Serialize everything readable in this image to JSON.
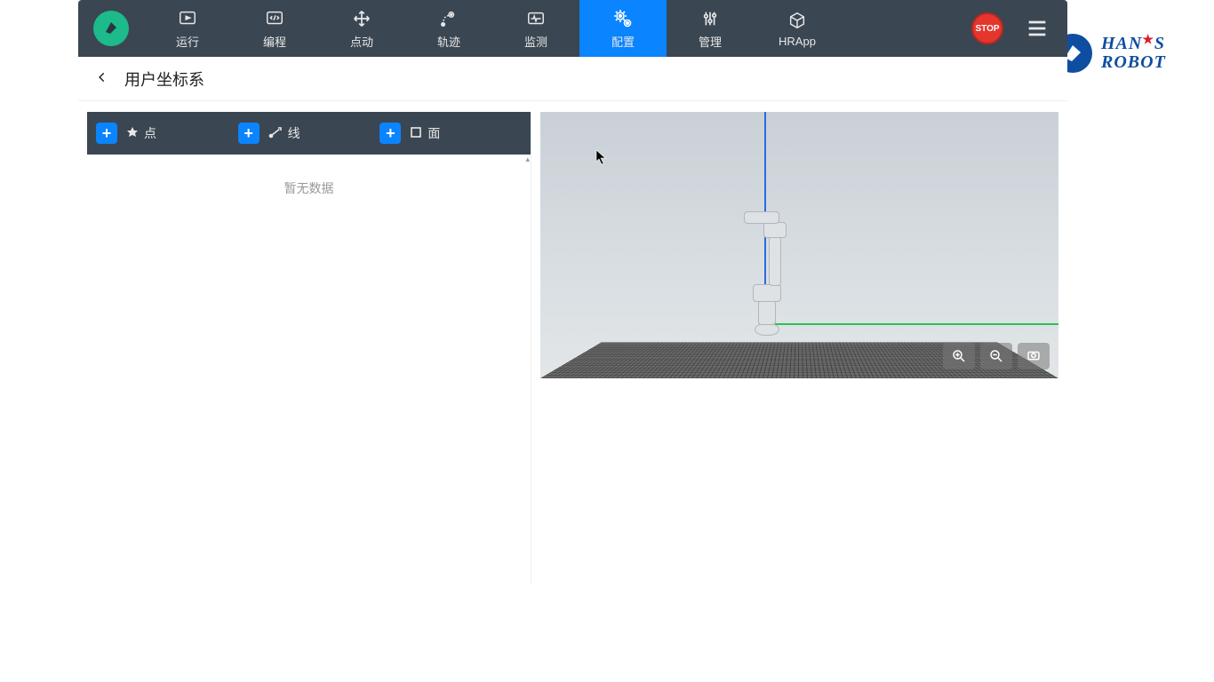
{
  "brand": {
    "line1_a": "HAN",
    "line1_b": "S",
    "line2": "ROBOT"
  },
  "nav": {
    "items": [
      {
        "label": "运行"
      },
      {
        "label": "编程"
      },
      {
        "label": "点动"
      },
      {
        "label": "轨迹"
      },
      {
        "label": "监测"
      },
      {
        "label": "配置",
        "active": true
      },
      {
        "label": "管理"
      },
      {
        "label": "HRApp"
      }
    ],
    "stop_label": "STOP"
  },
  "breadcrumb": {
    "title": "用户坐标系"
  },
  "left_toolbar": {
    "point": "点",
    "line": "线",
    "plane": "面"
  },
  "left_panel": {
    "no_data": "暂无数据"
  }
}
